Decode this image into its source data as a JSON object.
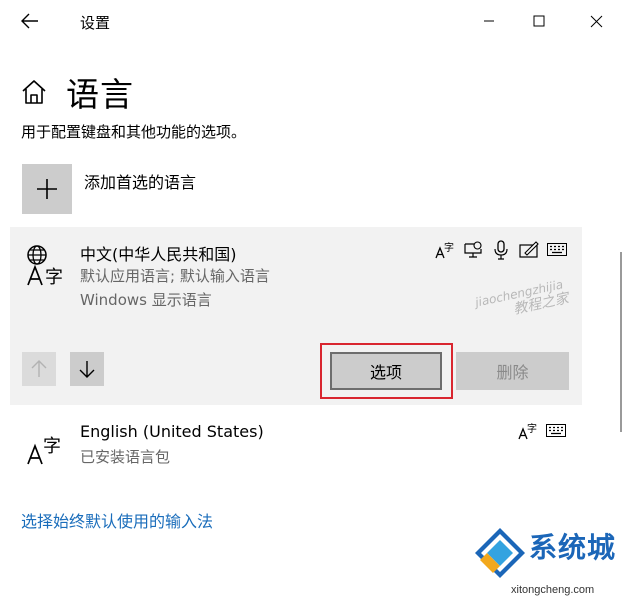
{
  "window": {
    "title": "设置",
    "back_icon": "arrow-left-icon",
    "minimize_icon": "minimize-icon",
    "maximize_icon": "maximize-icon",
    "close_icon": "close-icon"
  },
  "header": {
    "home_icon": "home-icon",
    "title": "语言"
  },
  "description": "用于配置键盘和其他功能的选项。",
  "add_language": {
    "icon": "plus-icon",
    "label": "添加首选的语言"
  },
  "languages": [
    {
      "name": "中文(中华人民共和国)",
      "line1": "默认应用语言; 默认输入语言",
      "line2": "Windows 显示语言",
      "icon": "language-globe-icon",
      "features": [
        "language-pack-icon",
        "display-language-icon",
        "speech-icon",
        "handwriting-icon",
        "keyboard-icon"
      ],
      "options_label": "选项",
      "delete_label": "删除"
    },
    {
      "name": "English (United States)",
      "line1": "已安装语言包",
      "icon": "language-icon",
      "features": [
        "language-pack-icon",
        "keyboard-icon"
      ]
    }
  ],
  "move_up_icon": "arrow-up-icon",
  "move_down_icon": "arrow-down-icon",
  "link": "选择始终默认使用的输入法",
  "watermark": {
    "line1": "jiaochengzhijia",
    "line2": "教程之家"
  },
  "brand": {
    "name": "系统城",
    "url": "xitongcheng.com"
  },
  "colors": {
    "accent_link": "#1a6dbb",
    "highlight": "#d9262f",
    "brand": "#1b66b8"
  }
}
